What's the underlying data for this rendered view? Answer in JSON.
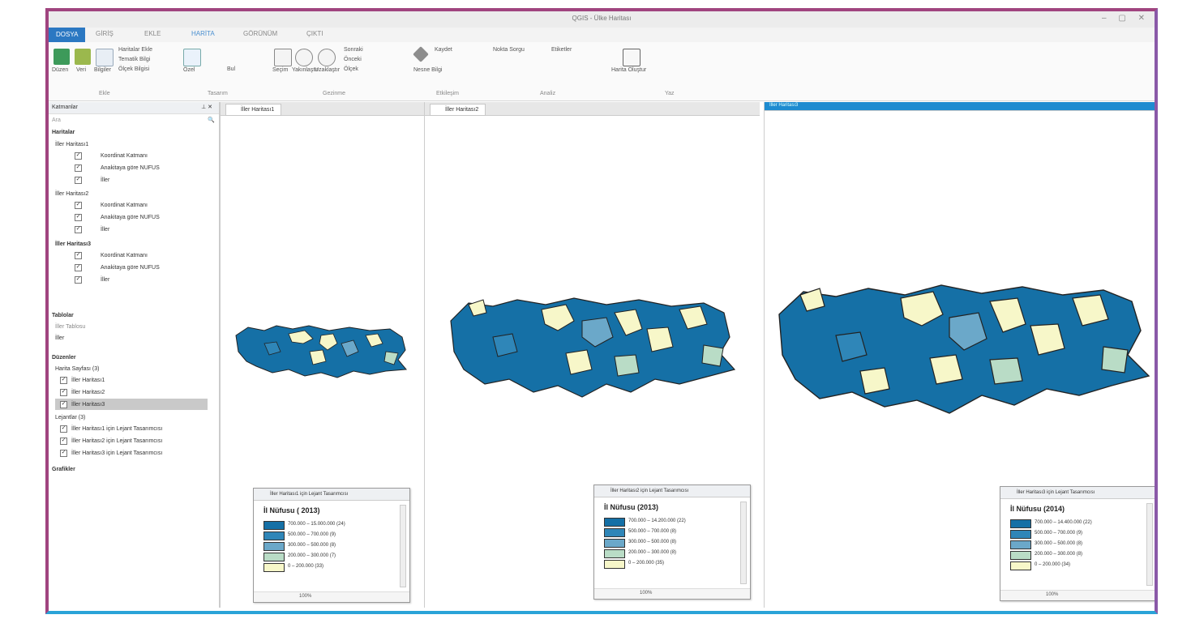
{
  "window": {
    "title": "QGIS - Ülke Haritası",
    "controls": "– ▢ ✕"
  },
  "menu": [
    {
      "label": "DOSYA",
      "state": "file"
    },
    {
      "label": "GİRİŞ",
      "state": ""
    },
    {
      "label": "EKLE",
      "state": ""
    },
    {
      "label": "HARİTA",
      "state": "active"
    },
    {
      "label": "GÖRÜNÜM",
      "state": ""
    },
    {
      "label": "ÇIKTI",
      "state": ""
    }
  ],
  "ribbon": {
    "groups": [
      "Ekle",
      "Tasarım",
      "Gezinme",
      "Etkileşim",
      "Analiz",
      "Yaz"
    ],
    "items": [
      "Düzen",
      "Veri",
      "Bilgiler",
      "Haritalar Ekle",
      "Tematik Bilgi",
      "Ölçek Bilgisi",
      "Özel",
      "Bul",
      "Seçim",
      "Yakınlaştır",
      "Uzaklaştır",
      "Sonraki",
      "Önceki",
      "Ölçek",
      "Nesne Bilgi",
      "Kaydet",
      "Nokta Sorgu",
      "Etiketler",
      "Harita Oluştur"
    ]
  },
  "left_panel": {
    "header": "Katmanlar",
    "search_placeholder": "Ara",
    "section_maps": "Haritalar",
    "maps": [
      {
        "name": "İller Haritası1",
        "layers": [
          "Koordinat Katmanı",
          "Anakitaya göre NUFUS",
          "İller"
        ]
      },
      {
        "name": "İller Haritası2",
        "layers": [
          "Koordinat Katmanı",
          "Anakitaya göre NUFUS",
          "İller"
        ]
      },
      {
        "name": "İller Haritası3",
        "layers": [
          "Koordinat Katmanı",
          "Anakitaya göre NUFUS",
          "İller"
        ]
      }
    ],
    "section_tables": "Tablolar",
    "tables_filter": "İller Tablosu",
    "tables_item": "İller",
    "section_layouts": "Düzenler",
    "layout_group": "Harita Sayfası (3)",
    "layout_items": [
      "İller Haritası1",
      "İller Haritası2",
      "İller Haritası3"
    ],
    "legend_group": "Lejantlar (3)",
    "legend_items": [
      "İller Haritası1 için Lejant Tasarımcısı",
      "İller Haritası2 için Lejant Tasarımcısı",
      "İller Haritası3 için Lejant Tasarımcısı"
    ],
    "section_charts": "Grafikler"
  },
  "map_windows": [
    {
      "tab": "İller Haritası1",
      "legend": {
        "header": "İller Haritası1 için Lejant Tasarımcısı",
        "title": "İl Nüfusu ( 2013)",
        "rows": [
          {
            "label": "700.000 – 15.000.000 (24)",
            "color": "#1570a6"
          },
          {
            "label": "500.000 –   700.000 (9)",
            "color": "#2f86b8"
          },
          {
            "label": "300.000 –   500.000 (8)",
            "color": "#6ba8c9"
          },
          {
            "label": "200.000 –   300.000 (7)",
            "color": "#b9dcc6"
          },
          {
            "label": "0 –   200.000 (33)",
            "color": "#f7f7c9"
          }
        ],
        "footer": "100%"
      }
    },
    {
      "tab": "İller Haritası2",
      "legend": {
        "header": "İller Haritası2 için Lejant Tasarımcısı",
        "title": "İl Nüfusu (2013)",
        "rows": [
          {
            "label": "700.000 – 14.200.000 (22)",
            "color": "#1570a6"
          },
          {
            "label": "500.000 –   700.000 (8)",
            "color": "#2f86b8"
          },
          {
            "label": "300.000 –   500.000 (8)",
            "color": "#6ba8c9"
          },
          {
            "label": "200.000 –   300.000 (8)",
            "color": "#b9dcc6"
          },
          {
            "label": "0 –   200.000 (35)",
            "color": "#f7f7c9"
          }
        ],
        "footer": "100%"
      }
    },
    {
      "tab": "İller Haritası3",
      "legend": {
        "header": "İller Haritası3 için Lejant Tasarımcısı",
        "title": "İl Nüfusu (2014)",
        "rows": [
          {
            "label": "700.000 – 14.400.000 (22)",
            "color": "#1570a6"
          },
          {
            "label": "500.000 –   700.000 (9)",
            "color": "#2f86b8"
          },
          {
            "label": "300.000 –   500.000 (8)",
            "color": "#6ba8c9"
          },
          {
            "label": "200.000 –   300.000 (8)",
            "color": "#b9dcc6"
          },
          {
            "label": "0 –   200.000 (34)",
            "color": "#f7f7c9"
          }
        ],
        "footer": "100%"
      }
    }
  ],
  "colors": {
    "frame_top": "#a0447f",
    "frame_bottom": "#2aa3d8",
    "class_high": "#1570a6",
    "class_mid": "#2f86b8",
    "class_low_mid": "#6ba8c9",
    "class_low": "#b9dcc6",
    "class_lowest": "#f7f7c9",
    "active_tab": "#1e8bd0"
  },
  "icons": [
    "app-icon",
    "data-icon",
    "info-icon",
    "zoom-tool-icon",
    "pan-hand-icon",
    "zoom-in-icon",
    "zoom-out-icon",
    "save-map-icon",
    "pin-icon",
    "close-icon",
    "pushpin-icon"
  ]
}
